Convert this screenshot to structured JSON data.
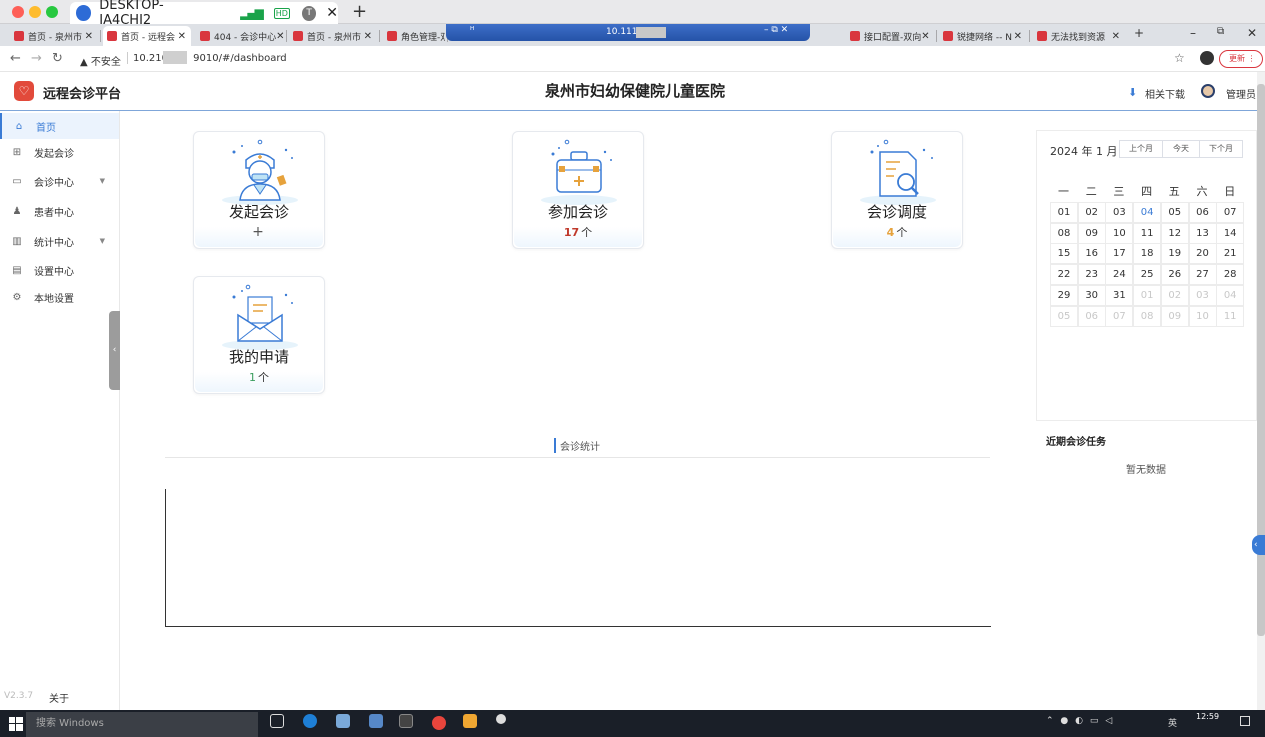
{
  "os": {
    "machine_title": "DESKTOP-IA4CHI2",
    "hd_badge": "HD",
    "t_badge": "T",
    "taskbar_search": "搜索 Windows",
    "clock": "12:59",
    "ime": "英"
  },
  "browser": {
    "tabs": [
      {
        "label": "首页 - 泉州市",
        "active": false
      },
      {
        "label": "首页 - 远程会",
        "active": true
      },
      {
        "label": "404 - 会诊中心",
        "active": false
      },
      {
        "label": "首页 - 泉州市",
        "active": false
      },
      {
        "label": "角色管理-双向",
        "active": false
      },
      {
        "label": "接口配置-双向",
        "active": false
      },
      {
        "label": "锐捷网络 -- N",
        "active": false
      },
      {
        "label": "无法找到资源",
        "active": false
      }
    ],
    "remote_host": "10.111",
    "security": "不安全",
    "url_prefix": "10.210.",
    "url_suffix": "9010/#/dashboard",
    "update_label": "更新"
  },
  "header": {
    "brand": "远程会诊平台",
    "hospital": "泉州市妇幼保健院儿童医院",
    "download": "相关下载",
    "user": "管理员"
  },
  "sidebar": {
    "items": [
      {
        "label": "首页",
        "icon": "home-icon",
        "active": true,
        "has_children": false
      },
      {
        "label": "发起会诊",
        "icon": "add-square-icon",
        "active": false,
        "has_children": false
      },
      {
        "label": "会诊中心",
        "icon": "monitor-icon",
        "active": false,
        "has_children": true
      },
      {
        "label": "患者中心",
        "icon": "user-icon",
        "active": false,
        "has_children": false
      },
      {
        "label": "统计中心",
        "icon": "chart-icon",
        "active": false,
        "has_children": true
      },
      {
        "label": "设置中心",
        "icon": "grid-icon",
        "active": false,
        "has_children": false
      },
      {
        "label": "本地设置",
        "icon": "gear-icon",
        "active": false,
        "has_children": false
      }
    ],
    "version": "V2.3.7",
    "about": "关于"
  },
  "cards": [
    {
      "title": "发起会诊",
      "count": "+",
      "unit": "",
      "count_color": "#333333",
      "icon": "doctor-icon"
    },
    {
      "title": "参加会诊",
      "count": "17",
      "unit": "个",
      "count_color": "#c0392b",
      "icon": "medical-kit-icon"
    },
    {
      "title": "会诊调度",
      "count": "4",
      "unit": "个",
      "count_color": "#e6a23c",
      "icon": "document-search-icon"
    },
    {
      "title": "我的申请",
      "count": "1",
      "unit": "个",
      "count_color": "#3a9d5d",
      "icon": "envelope-icon"
    }
  ],
  "calendar": {
    "title": "2024 年 1 月",
    "prev": "上个月",
    "today": "今天",
    "next": "下个月",
    "weekdays": [
      "一",
      "二",
      "三",
      "四",
      "五",
      "六",
      "日"
    ],
    "today_day": "04",
    "days": [
      [
        "01",
        "02",
        "03",
        "04",
        "05",
        "06",
        "07"
      ],
      [
        "08",
        "09",
        "10",
        "11",
        "12",
        "13",
        "14"
      ],
      [
        "15",
        "16",
        "17",
        "18",
        "19",
        "20",
        "21"
      ],
      [
        "22",
        "23",
        "24",
        "25",
        "26",
        "27",
        "28"
      ],
      [
        "29",
        "30",
        "31",
        "01",
        "02",
        "03",
        "04"
      ],
      [
        "05",
        "06",
        "07",
        "08",
        "09",
        "10",
        "11"
      ]
    ],
    "dim_from_index": 31
  },
  "recent": {
    "title": "近期会诊任务",
    "empty": "暂无数据"
  },
  "stats": {
    "title": "会诊统计"
  },
  "colors": {
    "accent": "#3a7bd5",
    "brand": "#e24a3b"
  }
}
